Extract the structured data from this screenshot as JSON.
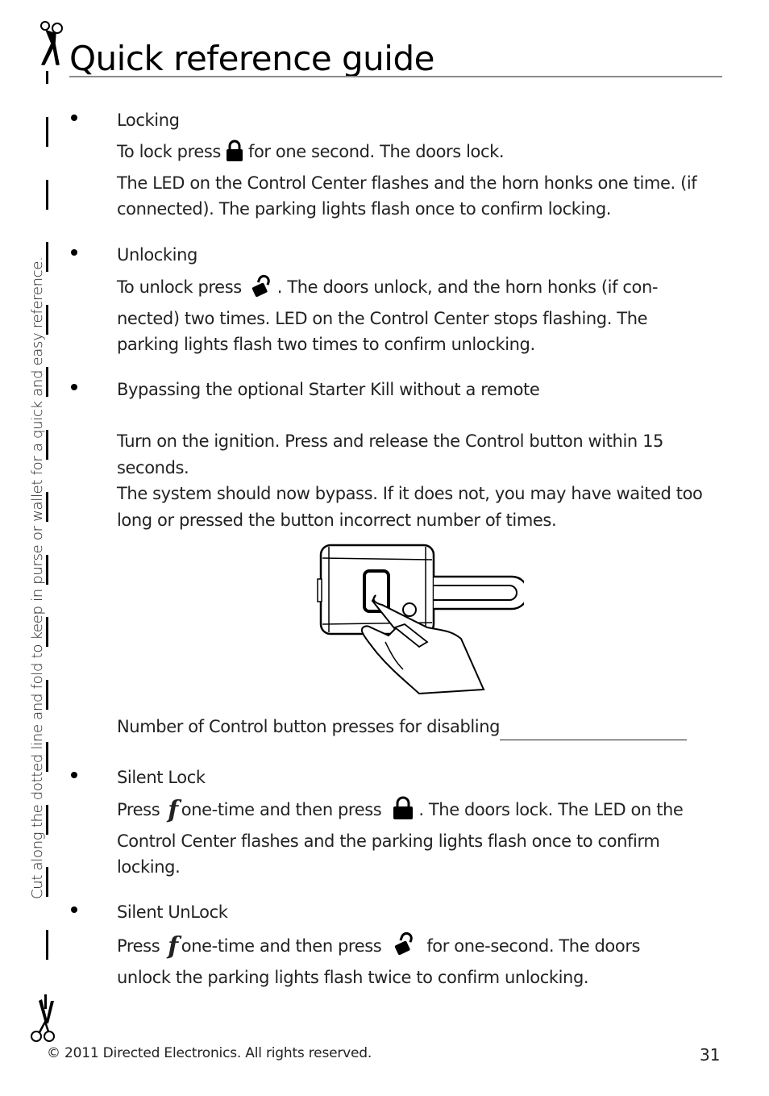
{
  "page": {
    "title": "Quick reference guide",
    "side_instruction": "Cut along the dotted line and fold to keep in purse or wallet for a quick and easy reference.",
    "footer": {
      "copyright": "© 2011 Directed Electronics. All rights reserved.",
      "page_number": "31"
    }
  },
  "sections": [
    {
      "heading": "Locking",
      "lines": [
        {
          "before": "To lock press",
          "icon": "lock-icon",
          "after": "for one second. The doors lock."
        },
        {
          "text": "The LED on the Control Center flashes and the horn honks one time. (if connected). The parking lights flash once to confirm locking."
        }
      ]
    },
    {
      "heading": "Unlocking",
      "lines": [
        {
          "before": "To unlock press",
          "icon": "unlock-icon",
          "after": ". The doors unlock, and the horn honks (if con-nected) two times.  LED on the Control Center stops flashing. The parking lights flash two times to confirm unlocking."
        }
      ]
    },
    {
      "heading": "Bypassing the optional Starter Kill without a remote",
      "paragraphs": [
        "Turn on the ignition. Press and release the Control button within 15 seconds.",
        "The system should now bypass. If it does not, you may have waited too long or pressed the button incorrect number of times."
      ],
      "illustration": "hand-pressing-control-center-button",
      "fill_in_label": "Number of Control button presses for disabling"
    },
    {
      "heading": "Silent Lock",
      "lines": [
        {
          "p1": "Press",
          "f_icon": "function-icon",
          "p2": "one-time and then press",
          "icon": "lock-icon",
          "after": ". The doors lock. The LED  on the Control Center flashes and the parking lights flash once to confirm locking."
        }
      ]
    },
    {
      "heading": "Silent UnLock",
      "lines": [
        {
          "p1": "Press",
          "f_icon": "function-icon",
          "p2": "one-time and then press",
          "icon": "unlock-icon",
          "after": "for one-second. The doors unlock the parking lights flash twice to confirm unlocking."
        }
      ]
    }
  ],
  "glyphs": {
    "function": "f"
  }
}
